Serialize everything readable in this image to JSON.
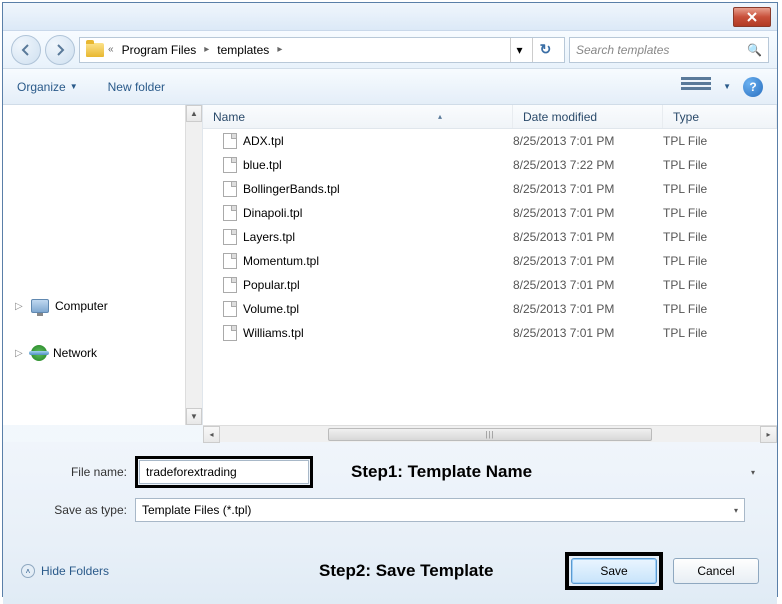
{
  "breadcrumb": {
    "sep": "«",
    "item1": "Program Files",
    "item2": "templates"
  },
  "search": {
    "placeholder": "Search templates"
  },
  "toolbar": {
    "organize": "Organize",
    "newfolder": "New folder"
  },
  "sidebar": {
    "computer": "Computer",
    "network": "Network"
  },
  "columns": {
    "name": "Name",
    "date": "Date modified",
    "type": "Type"
  },
  "files": [
    {
      "name": "ADX.tpl",
      "date": "8/25/2013 7:01 PM",
      "type": "TPL File"
    },
    {
      "name": "blue.tpl",
      "date": "8/25/2013 7:22 PM",
      "type": "TPL File"
    },
    {
      "name": "BollingerBands.tpl",
      "date": "8/25/2013 7:01 PM",
      "type": "TPL File"
    },
    {
      "name": "Dinapoli.tpl",
      "date": "8/25/2013 7:01 PM",
      "type": "TPL File"
    },
    {
      "name": "Layers.tpl",
      "date": "8/25/2013 7:01 PM",
      "type": "TPL File"
    },
    {
      "name": "Momentum.tpl",
      "date": "8/25/2013 7:01 PM",
      "type": "TPL File"
    },
    {
      "name": "Popular.tpl",
      "date": "8/25/2013 7:01 PM",
      "type": "TPL File"
    },
    {
      "name": "Volume.tpl",
      "date": "8/25/2013 7:01 PM",
      "type": "TPL File"
    },
    {
      "name": "Williams.tpl",
      "date": "8/25/2013 7:01 PM",
      "type": "TPL File"
    }
  ],
  "form": {
    "filename_label": "File name:",
    "filename_value": "tradeforextrading",
    "saveas_label": "Save as type:",
    "saveas_value": "Template Files (*.tpl)"
  },
  "annotations": {
    "step1": "Step1: Template Name",
    "step2": "Step2: Save Template"
  },
  "footer": {
    "hide": "Hide Folders",
    "save": "Save",
    "cancel": "Cancel"
  },
  "help": "?"
}
